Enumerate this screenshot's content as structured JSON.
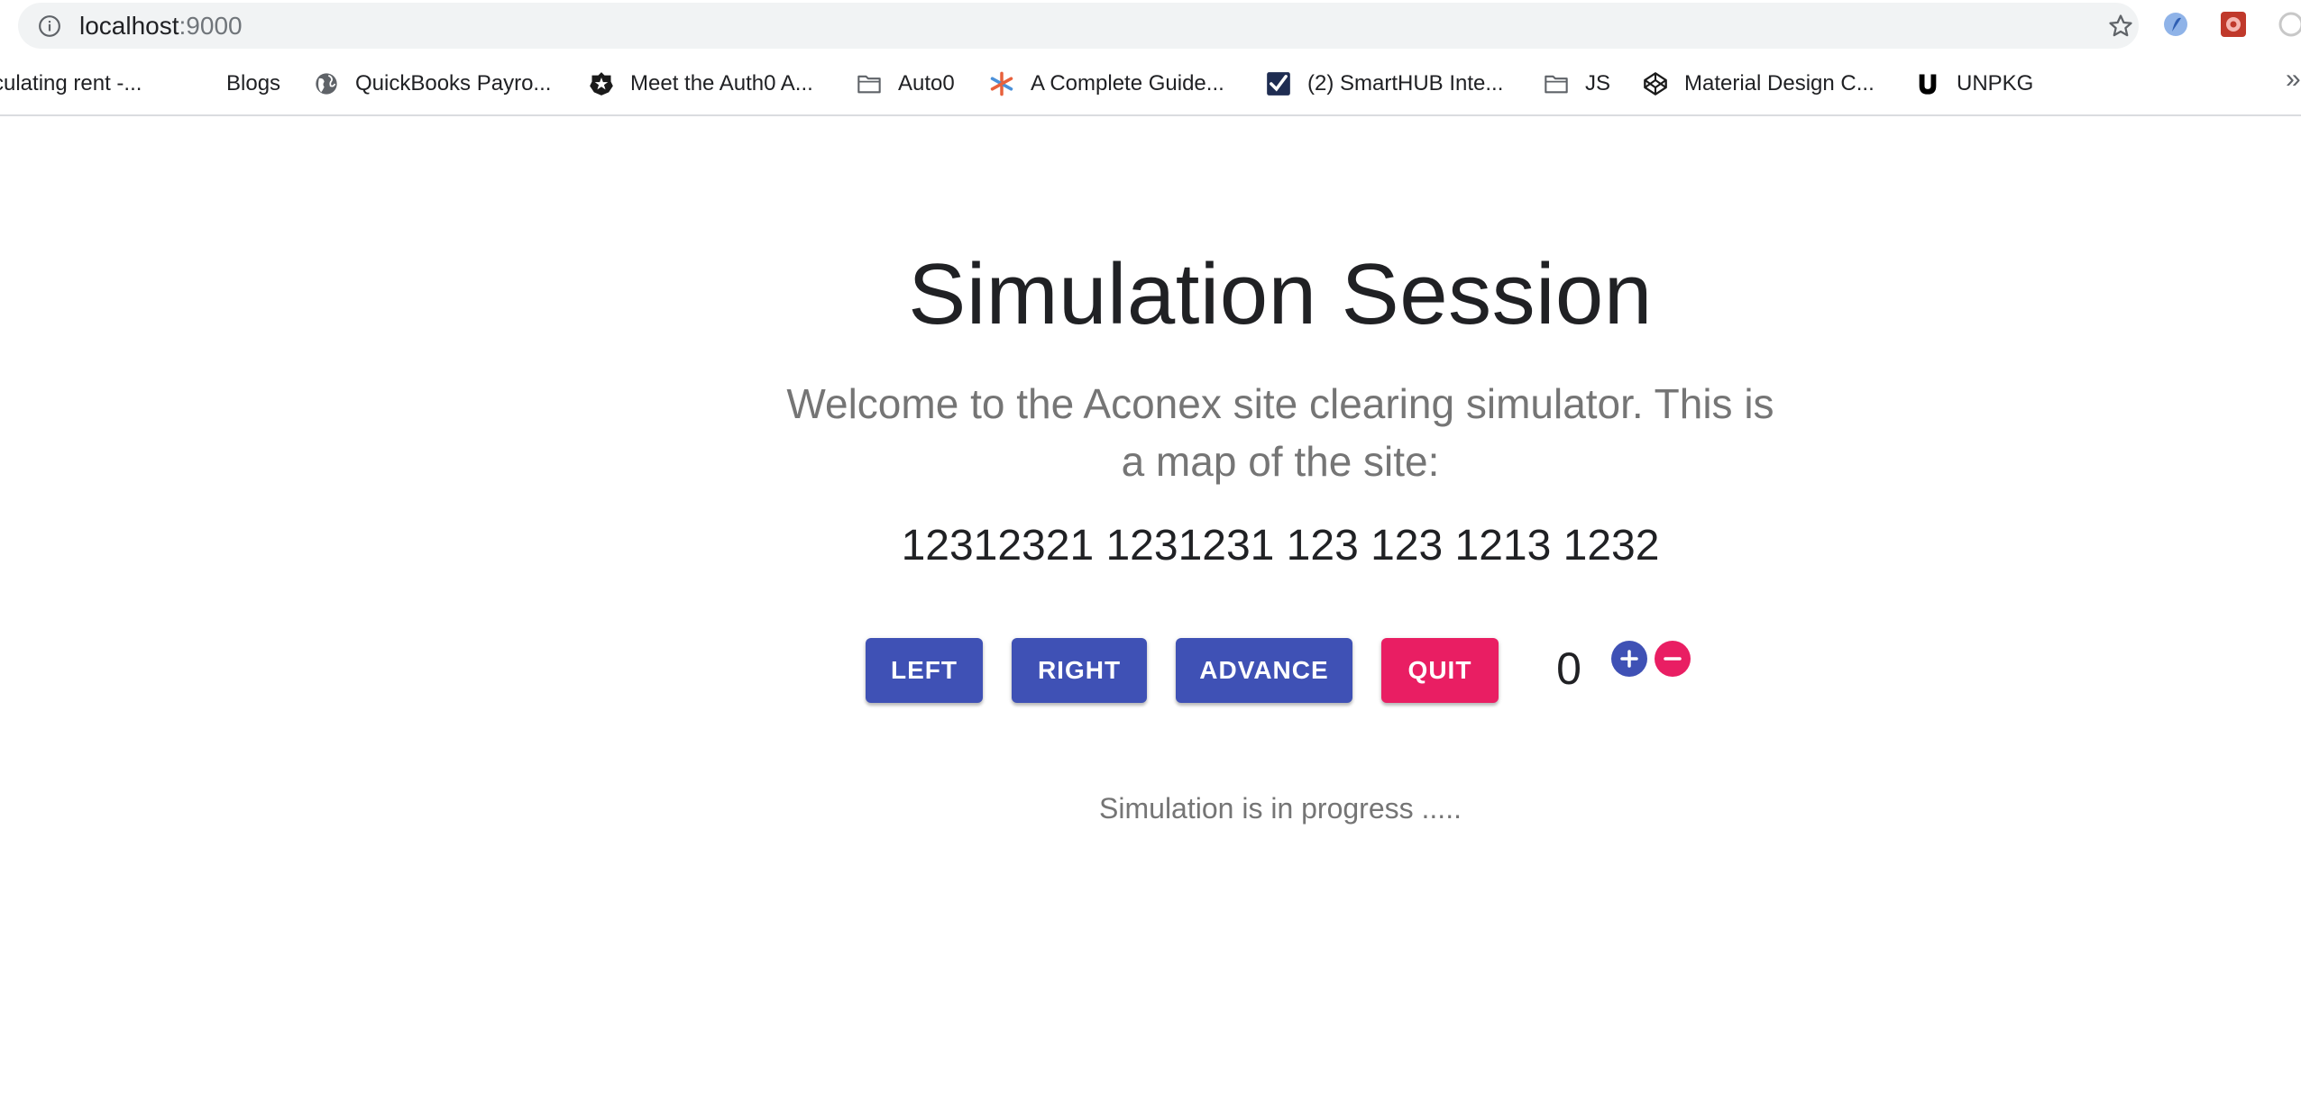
{
  "browser": {
    "url_host": "localhost",
    "url_port": ":9000",
    "bookmarks": [
      {
        "label": "culating rent -...",
        "icon": "none"
      },
      {
        "label": "Blogs",
        "icon": "none"
      },
      {
        "label": "QuickBooks Payro...",
        "icon": "globe-icon"
      },
      {
        "label": "Meet the Auth0 A...",
        "icon": "auth0-icon"
      },
      {
        "label": "Auto0",
        "icon": "folder-icon"
      },
      {
        "label": "A Complete Guide...",
        "icon": "asterisk-icon"
      },
      {
        "label": "(2) SmartHUB Inte...",
        "icon": "checkmark-icon"
      },
      {
        "label": "JS",
        "icon": "folder-icon"
      },
      {
        "label": "Material Design C...",
        "icon": "codepen-icon"
      },
      {
        "label": "UNPKG",
        "icon": "unpkg-icon"
      }
    ],
    "more_label": "»"
  },
  "page": {
    "title": "Simulation Session",
    "welcome": "Welcome to the Aconex site clearing simulator. This is a map of the site:",
    "map": "12312321 1231231 123 123 1213 1232",
    "buttons": {
      "left": "LEFT",
      "right": "RIGHT",
      "advance": "ADVANCE",
      "quit": "QUIT"
    },
    "counter": "0",
    "status": "Simulation is in progress ....."
  },
  "colors": {
    "primary": "#3f51b5",
    "accent": "#e91e63"
  }
}
